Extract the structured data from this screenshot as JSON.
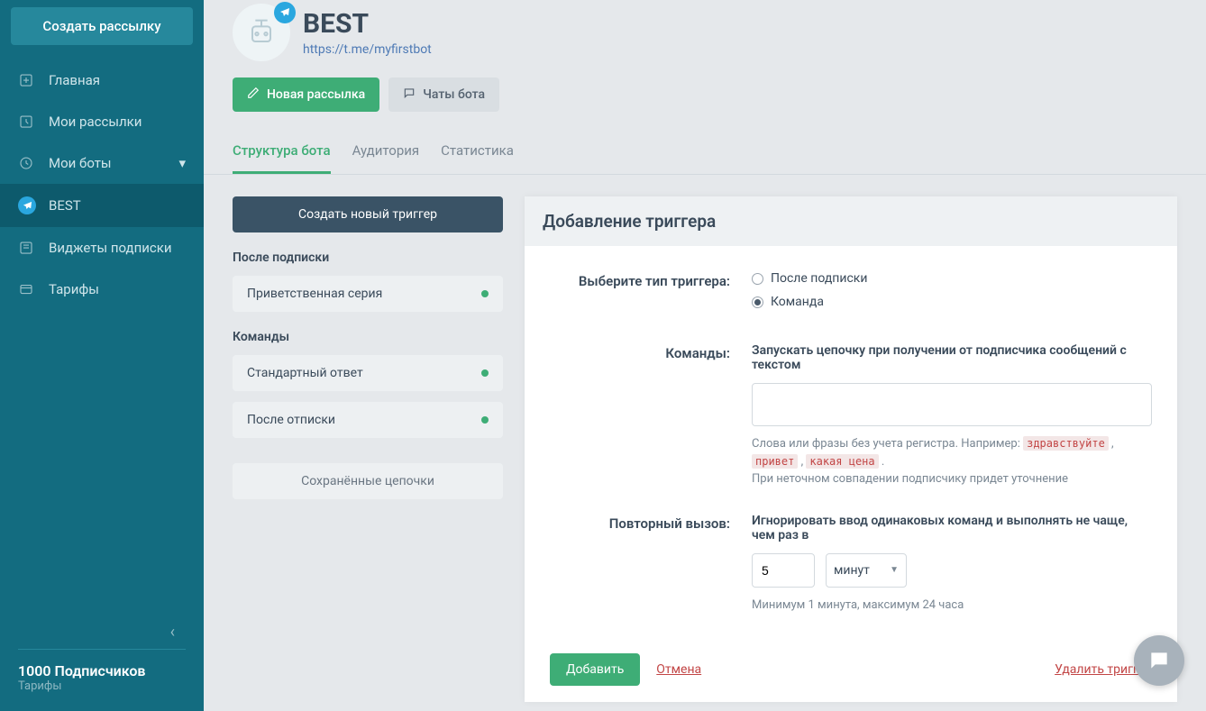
{
  "sidebar": {
    "create_button": "Создать рассылку",
    "items": [
      {
        "label": "Главная"
      },
      {
        "label": "Мои рассылки"
      },
      {
        "label": "Мои боты"
      },
      {
        "label": "BEST"
      },
      {
        "label": "Виджеты подписки"
      },
      {
        "label": "Тарифы"
      }
    ],
    "subscribers": "1000 Подписчиков",
    "tariffs": "Тарифы"
  },
  "bot": {
    "name": "BEST",
    "link": "https://t.me/myfirstbot",
    "new_campaign": "Новая рассылка",
    "bot_chats": "Чаты бота"
  },
  "tabs": [
    {
      "label": "Структура бота",
      "active": true
    },
    {
      "label": "Аудитория",
      "active": false
    },
    {
      "label": "Статистика",
      "active": false
    }
  ],
  "triggers": {
    "create_button": "Создать новый триггер",
    "section_after_subscribe": "После подписки",
    "after_subscribe_items": [
      "Приветственная серия"
    ],
    "section_commands": "Команды",
    "command_items": [
      "Стандартный ответ",
      "После отписки"
    ],
    "saved_chains": "Сохранённые цепочки"
  },
  "panel": {
    "title": "Добавление триггера",
    "type_label": "Выберите тип триггера:",
    "type_options": [
      "После подписки",
      "Команда"
    ],
    "commands_label": "Команды:",
    "commands_desc": "Запускать цепочку при получении от подписчика сообщений с текстом",
    "commands_hint_pre": "Слова или фразы без учета регистра. Например: ",
    "commands_hint_ex1": "здравствуйте",
    "commands_hint_ex2": "привет",
    "commands_hint_ex3": "какая цена",
    "commands_hint_post": "При неточном совпадении подписчику придет уточнение",
    "repeat_label": "Повторный вызов:",
    "repeat_desc": "Игнорировать ввод одинаковых команд и выполнять не чаще, чем раз в",
    "repeat_value": "5",
    "repeat_unit": "минут",
    "repeat_hint": "Минимум 1 минута, максимум 24 часа",
    "add_button": "Добавить",
    "cancel_button": "Отмена",
    "delete_button": "Удалить триггер"
  }
}
